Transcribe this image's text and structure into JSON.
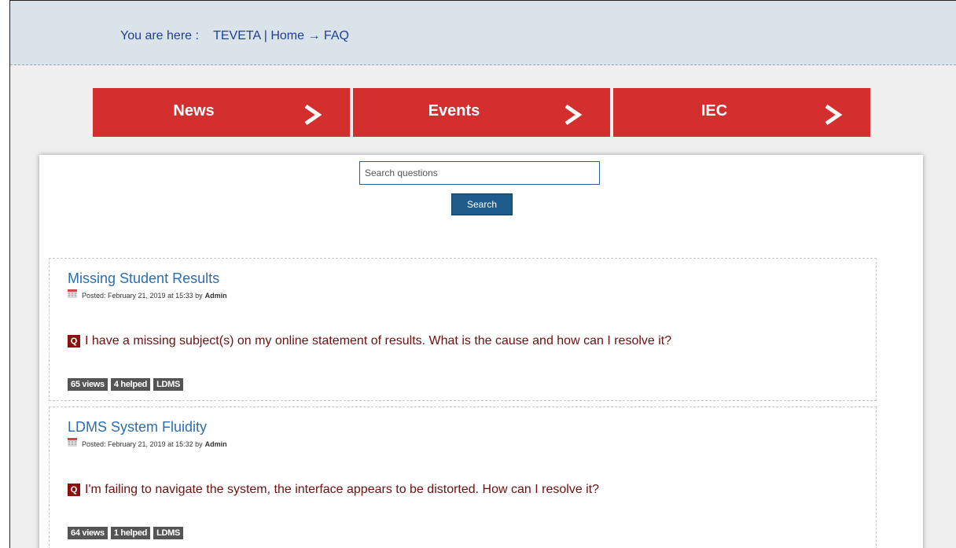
{
  "breadcrumb": {
    "prefix": "You are here :",
    "site": "TEVETA",
    "separator": "|",
    "home": "Home",
    "arrow": "→",
    "current": "FAQ"
  },
  "quicklinks": [
    {
      "label": "News"
    },
    {
      "label": "Events"
    },
    {
      "label": "IEC"
    }
  ],
  "search": {
    "placeholder": "Search questions",
    "value": "",
    "button_label": "Search"
  },
  "faqs": [
    {
      "title": "Missing Student Results",
      "posted_prefix": "Posted: February 21, 2019 at 15:33 by",
      "author": "Admin",
      "badge": "Q",
      "question": "I have a missing subject(s) on my online statement of results. What is the cause and how can I resolve it?",
      "views": "65 views",
      "helped": "4 helped",
      "tag": "LDMS"
    },
    {
      "title": "LDMS System Fluidity",
      "posted_prefix": "Posted: February 21, 2019 at 15:32 by",
      "author": "Admin",
      "badge": "Q",
      "question": "I'm failing to navigate the system, the interface appears to be distorted. How can I resolve it?",
      "views": "64 views",
      "helped": "1 helped",
      "tag": "LDMS"
    }
  ],
  "colors": {
    "accent_red": "#d32f2f",
    "link_blue": "#2a6fb0",
    "question_red": "#6e1010",
    "button_blue": "#1e5a8a"
  },
  "icons": {
    "quicklink_arrow": "chevron-right-icon",
    "posted": "calendar-icon"
  }
}
